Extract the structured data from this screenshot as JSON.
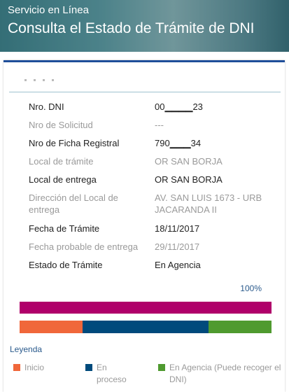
{
  "header": {
    "service_label": "Servicio en Línea",
    "title": "Consulta el Estado de Trámite de DNI"
  },
  "details": [
    {
      "label": "Nro. DNI",
      "value": "00▁▁▁▁23",
      "style": "dark"
    },
    {
      "label": "Nro de Solicitud",
      "value": "---",
      "style": "light"
    },
    {
      "label": "Nro de Ficha Registral",
      "value": "790▁▁▁34",
      "style": "dark"
    },
    {
      "label": "Local de trámite",
      "value": "OR SAN BORJA",
      "style": "light"
    },
    {
      "label": "Local de entrega",
      "value": "OR SAN BORJA",
      "style": "dark"
    },
    {
      "label": "Dirección del Local de entrega",
      "value": "AV. SAN LUIS 1673 - URB JACARANDA II",
      "style": "light"
    },
    {
      "label": "Fecha de Trámite",
      "value": "18/11/2017",
      "style": "dark"
    },
    {
      "label": "Fecha probable de entrega",
      "value": "29/11/2017",
      "style": "light"
    },
    {
      "label": "Estado de Trámite",
      "value": "En Agencia",
      "style": "dark"
    }
  ],
  "progress": {
    "percent_label": "100%",
    "fraction": 1.0,
    "bar_color": "#b0006a"
  },
  "stages": [
    {
      "name": "Inicio",
      "color": "#f0673a"
    },
    {
      "name": "En proceso",
      "color": "#004a7c"
    },
    {
      "name": "En Agencia (Puede recoger el DNI)",
      "color": "#4f9a2f"
    }
  ],
  "legend": {
    "title": "Leyenda"
  }
}
